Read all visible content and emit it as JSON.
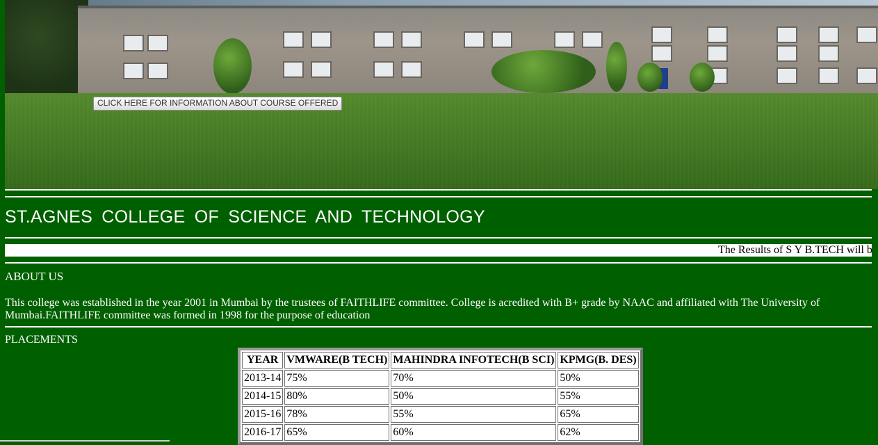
{
  "hero": {
    "course_button_label": "CLICK HERE FOR INFORMATION ABOUT COURSE OFFERED"
  },
  "college": {
    "title": "ST.AGNES COLLEGE OF SCIENCE AND TECHNOLOGY"
  },
  "marquee": {
    "text": "The Results of S Y B.TECH will b"
  },
  "about": {
    "heading": "ABOUT US",
    "text": "This college was established in the year 2001 in Mumbai by the trustees of FAITHLIFE committee. College is acredited with B+ grade by NAAC and affiliated with The University of Mumbai.FAITHLIFE committee was formed in 1998 for the purpose of education"
  },
  "placements": {
    "heading": "PLACEMENTS",
    "headers": [
      "YEAR",
      "VMWARE(B TECH)",
      "MAHINDRA INFOTECH(B SCI)",
      "KPMG(B. DES)"
    ],
    "rows": [
      [
        "2013-14",
        "75%",
        "70%",
        "50%"
      ],
      [
        "2014-15",
        "80%",
        "50%",
        "55%"
      ],
      [
        "2015-16",
        "78%",
        "55%",
        "65%"
      ],
      [
        "2016-17",
        "65%",
        "60%",
        "62%"
      ]
    ]
  },
  "colors": {
    "page_background": "#006000",
    "text": "#ffffff"
  }
}
